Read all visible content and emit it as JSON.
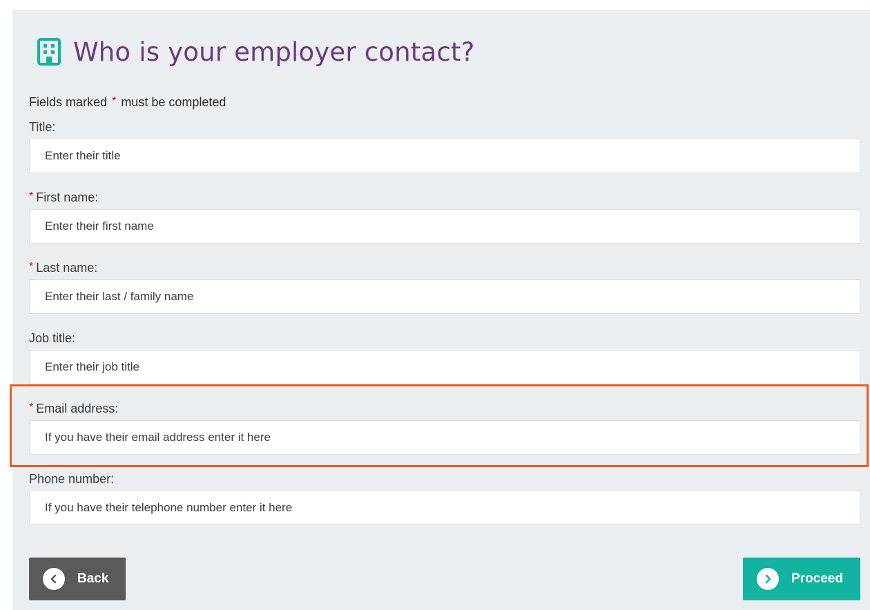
{
  "header": {
    "icon": "building-icon",
    "title": "Who is your employer contact?"
  },
  "form": {
    "required_note_prefix": "Fields marked",
    "required_note_star": "*",
    "required_note_suffix": "must be completed",
    "required_star": "*",
    "fields": [
      {
        "label": "Title:",
        "required": false,
        "placeholder": "Enter their title"
      },
      {
        "label": "First name:",
        "required": true,
        "placeholder": "Enter their first name"
      },
      {
        "label": "Last name:",
        "required": true,
        "placeholder": "Enter their last / family name"
      },
      {
        "label": "Job title:",
        "required": false,
        "placeholder": "Enter their job title"
      },
      {
        "label": "Email address:",
        "required": true,
        "placeholder": "If you have their email address enter it here"
      },
      {
        "label": "Phone number:",
        "required": false,
        "placeholder": "If you have their telephone number enter it here"
      }
    ]
  },
  "actions": {
    "back_label": "Back",
    "back_icon": "chevron-left-icon",
    "proceed_label": "Proceed",
    "proceed_icon": "chevron-right-icon"
  },
  "colors": {
    "title": "#6b3a7c",
    "icon": "#12b3a0",
    "required_star": "#d0021b",
    "highlight": "#f05a1c",
    "back_button": "#5a5a5a",
    "proceed_button": "#12b3a0",
    "page_background": "#ebeef0"
  }
}
